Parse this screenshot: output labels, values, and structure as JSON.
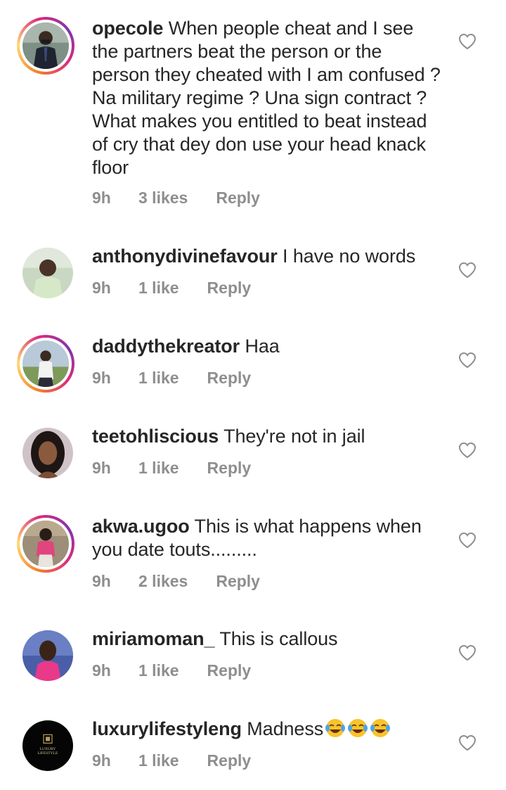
{
  "comments": [
    {
      "username": "opecole",
      "text": "When people cheat and I see the partners beat the person or the person they cheated with I am confused ? Na military regime ? Una sign contract ? What makes you entitled to beat instead of cry that dey don use your head knack floor",
      "time": "9h",
      "likes": "3 likes",
      "reply": "Reply",
      "has_story_ring": true
    },
    {
      "username": "anthonydivinefavour",
      "text": "I have no words",
      "time": "9h",
      "likes": "1 like",
      "reply": "Reply",
      "has_story_ring": false
    },
    {
      "username": "daddythekreator",
      "text": "Haa",
      "time": "9h",
      "likes": "1 like",
      "reply": "Reply",
      "has_story_ring": true
    },
    {
      "username": "teetohliscious",
      "text": "They're not in jail",
      "time": "9h",
      "likes": "1 like",
      "reply": "Reply",
      "has_story_ring": false
    },
    {
      "username": "akwa.ugoo",
      "text": "This is what happens when you date touts.........",
      "time": "9h",
      "likes": "2 likes",
      "reply": "Reply",
      "has_story_ring": true
    },
    {
      "username": "miriamoman_",
      "text": "This is callous",
      "time": "9h",
      "likes": "1 like",
      "reply": "Reply",
      "has_story_ring": false
    },
    {
      "username": "luxurylifestyleng",
      "text": "Madness",
      "emoji": "😂😂😂",
      "time": "9h",
      "likes": "1 like",
      "reply": "Reply",
      "has_story_ring": false,
      "avatar_logo_text": "LUXURY LIFESTYLE"
    }
  ],
  "colors": {
    "text": "#262626",
    "meta": "#8e8e8e",
    "heart": "#8e8e8e"
  }
}
